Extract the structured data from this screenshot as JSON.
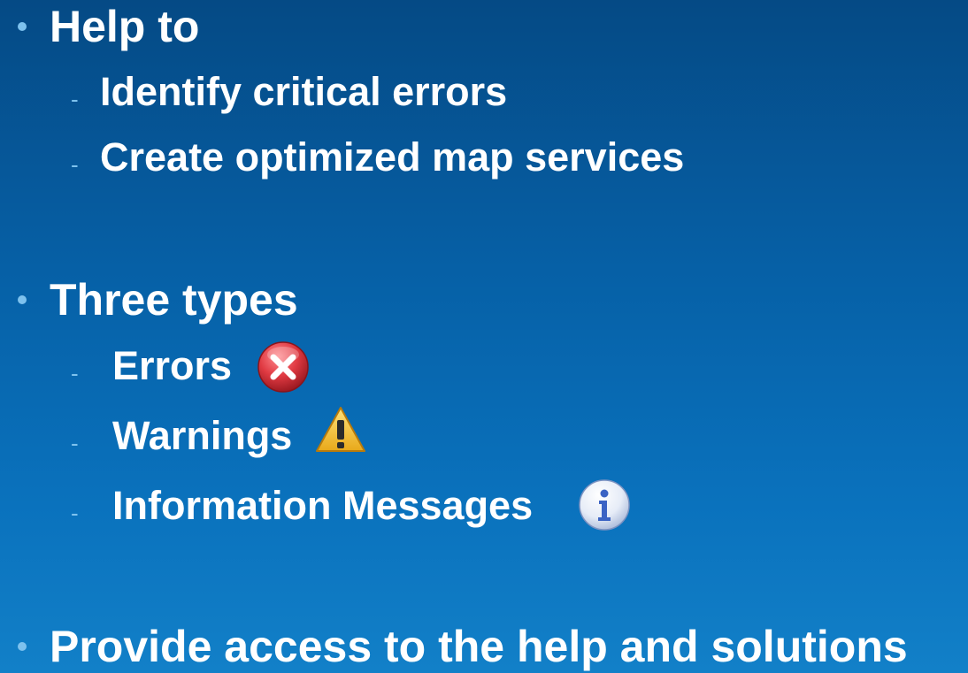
{
  "bullets": [
    {
      "text": "Help to",
      "sub": [
        {
          "text": "Identify critical errors"
        },
        {
          "text": "Create optimized map services"
        }
      ]
    },
    {
      "text": "Three types",
      "sub": [
        {
          "text": "Errors",
          "icon": "error-icon"
        },
        {
          "text": "Warnings",
          "icon": "warning-icon"
        },
        {
          "text": "Information Messages",
          "icon": "info-icon"
        }
      ]
    },
    {
      "text": "Provide access to the help and solutions"
    }
  ],
  "dash_glyph": "-",
  "colors": {
    "bullet": "#7ec2ee",
    "error": "#d9343c",
    "warning": "#f3c23a",
    "info": "#3b63c4"
  }
}
